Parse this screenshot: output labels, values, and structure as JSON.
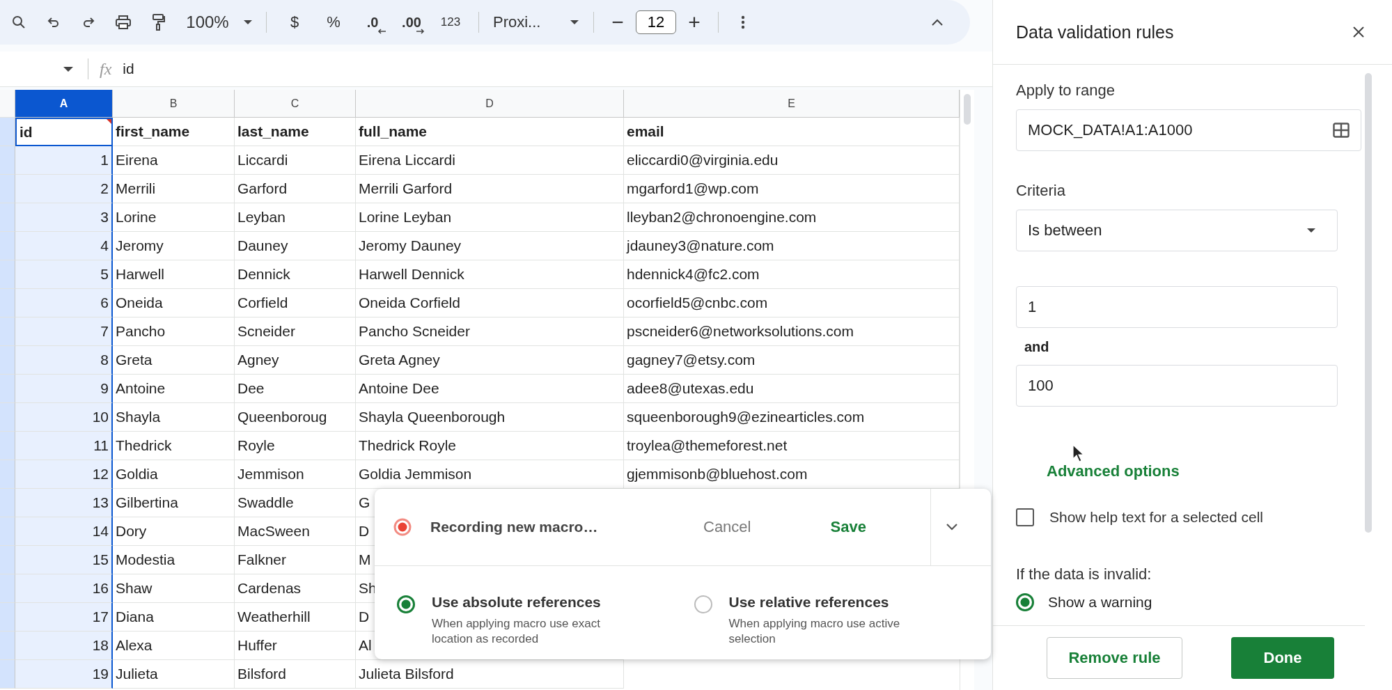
{
  "toolbar": {
    "zoom": "100%",
    "currency": "$",
    "percent": "%",
    "decrease_decimals": ".0",
    "increase_decimals": ".00",
    "number_format": "123",
    "font": "Proxi...",
    "font_size_minus": "−",
    "font_size": "12",
    "font_size_plus": "+"
  },
  "formula_bar": {
    "fx": "fx",
    "value": "id"
  },
  "sheet": {
    "columns": [
      {
        "label": "A",
        "selected": true
      },
      {
        "label": "B",
        "selected": false
      },
      {
        "label": "C",
        "selected": false
      },
      {
        "label": "D",
        "selected": false
      },
      {
        "label": "E",
        "selected": false
      }
    ],
    "rows": [
      {
        "kind": "header",
        "cells": [
          "id",
          "first_name",
          "last_name",
          "full_name",
          "email"
        ]
      },
      {
        "kind": "data",
        "cells": [
          "1",
          "Eirena",
          "Liccardi",
          "Eirena Liccardi",
          "eliccardi0@virginia.edu"
        ]
      },
      {
        "kind": "data",
        "cells": [
          "2",
          "Merrili",
          "Garford",
          "Merrili Garford",
          "mgarford1@wp.com"
        ]
      },
      {
        "kind": "data",
        "cells": [
          "3",
          "Lorine",
          "Leyban",
          "Lorine Leyban",
          "lleyban2@chronoengine.com"
        ]
      },
      {
        "kind": "data",
        "cells": [
          "4",
          "Jeromy",
          "Dauney",
          "Jeromy Dauney",
          "jdauney3@nature.com"
        ]
      },
      {
        "kind": "data",
        "cells": [
          "5",
          "Harwell",
          "Dennick",
          "Harwell Dennick",
          "hdennick4@fc2.com"
        ]
      },
      {
        "kind": "data",
        "cells": [
          "6",
          "Oneida",
          "Corfield",
          "Oneida Corfield",
          "ocorfield5@cnbc.com"
        ]
      },
      {
        "kind": "data",
        "cells": [
          "7",
          "Pancho",
          "Scneider",
          "Pancho Scneider",
          "pscneider6@networksolutions.com"
        ]
      },
      {
        "kind": "data",
        "cells": [
          "8",
          "Greta",
          "Agney",
          "Greta Agney",
          "gagney7@etsy.com"
        ]
      },
      {
        "kind": "data",
        "cells": [
          "9",
          "Antoine",
          "Dee",
          "Antoine Dee",
          "adee8@utexas.edu"
        ]
      },
      {
        "kind": "data",
        "cells": [
          "10",
          "Shayla",
          "Queenboroug",
          "Shayla Queenborough",
          "squeenborough9@ezinearticles.com"
        ]
      },
      {
        "kind": "data",
        "cells": [
          "11",
          "Thedrick",
          "Royle",
          "Thedrick Royle",
          "troylea@themeforest.net"
        ]
      },
      {
        "kind": "data",
        "cells": [
          "12",
          "Goldia",
          "Jemmison",
          "Goldia Jemmison",
          "gjemmisonb@bluehost.com"
        ]
      },
      {
        "kind": "data",
        "cells": [
          "13",
          "Gilbertina",
          "Swaddle",
          "G"
        ]
      },
      {
        "kind": "data",
        "cells": [
          "14",
          "Dory",
          "MacSween",
          "D"
        ]
      },
      {
        "kind": "data",
        "cells": [
          "15",
          "Modestia",
          "Falkner",
          "M"
        ]
      },
      {
        "kind": "data",
        "cells": [
          "16",
          "Shaw",
          "Cardenas",
          "Sh"
        ]
      },
      {
        "kind": "data",
        "cells": [
          "17",
          "Diana",
          "Weatherhill",
          "D"
        ]
      },
      {
        "kind": "data",
        "cells": [
          "18",
          "Alexa",
          "Huffer",
          "Al"
        ]
      },
      {
        "kind": "data",
        "cells": [
          "19",
          "Julieta",
          "Bilsford",
          "Julieta Bilsford"
        ]
      }
    ]
  },
  "macro_popup": {
    "status": "Recording new macro…",
    "cancel": "Cancel",
    "save": "Save",
    "options": [
      {
        "title": "Use absolute references",
        "description": "When applying macro use exact location as recorded",
        "selected": true
      },
      {
        "title": "Use relative references",
        "description": "When applying macro use active selection",
        "selected": false
      }
    ]
  },
  "panel": {
    "title": "Data validation rules",
    "range_label": "Apply to range",
    "range": "MOCK_DATA!A1:A1000",
    "criteria_label": "Criteria",
    "criteria": "Is between",
    "min": "1",
    "and": "and",
    "max": "100",
    "advanced": "Advanced options",
    "help_text": {
      "label": "Show help text for a selected cell",
      "checked": false
    },
    "invalid_label": "If the data is invalid:",
    "invalid_options": [
      {
        "label": "Show a warning",
        "selected": true
      }
    ],
    "remove": "Remove rule",
    "done": "Done"
  }
}
